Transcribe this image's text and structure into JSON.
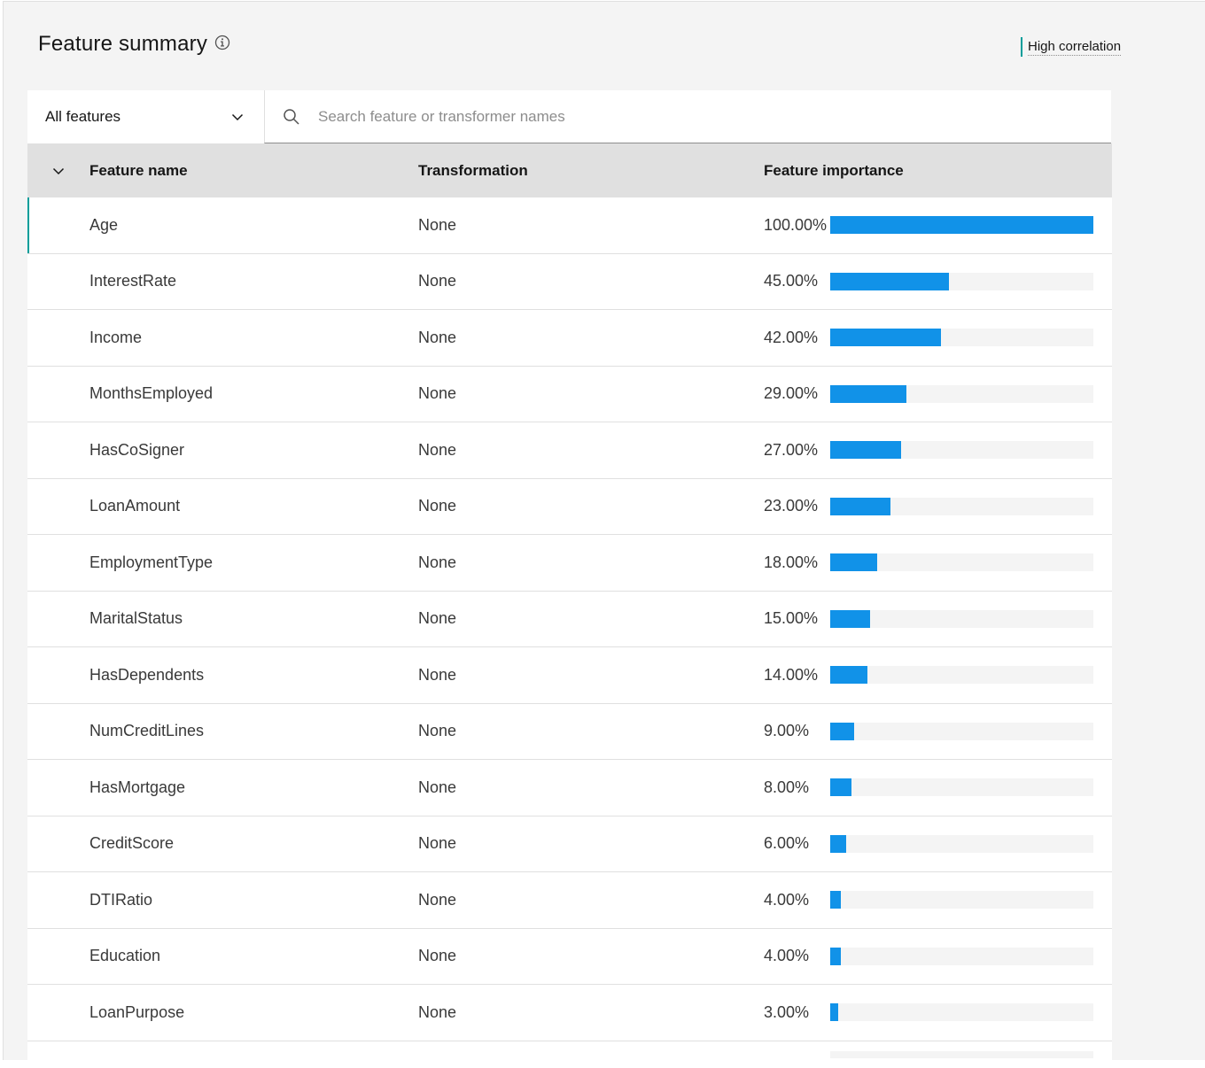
{
  "header": {
    "title": "Feature summary",
    "legend_label": "High correlation",
    "legend_color": "#009d9a"
  },
  "toolbar": {
    "filter_value": "All features",
    "search_placeholder": "Search feature or transformer names"
  },
  "table": {
    "columns": [
      "Feature name",
      "Transformation",
      "Feature importance"
    ],
    "bar_color": "#1192e8",
    "rows": [
      {
        "name": "Age",
        "transformation": "None",
        "importance": "100.00%",
        "value": 100
      },
      {
        "name": "InterestRate",
        "transformation": "None",
        "importance": "45.00%",
        "value": 45
      },
      {
        "name": "Income",
        "transformation": "None",
        "importance": "42.00%",
        "value": 42
      },
      {
        "name": "MonthsEmployed",
        "transformation": "None",
        "importance": "29.00%",
        "value": 29
      },
      {
        "name": "HasCoSigner",
        "transformation": "None",
        "importance": "27.00%",
        "value": 27
      },
      {
        "name": "LoanAmount",
        "transformation": "None",
        "importance": "23.00%",
        "value": 23
      },
      {
        "name": "EmploymentType",
        "transformation": "None",
        "importance": "18.00%",
        "value": 18
      },
      {
        "name": "MaritalStatus",
        "transformation": "None",
        "importance": "15.00%",
        "value": 15
      },
      {
        "name": "HasDependents",
        "transformation": "None",
        "importance": "14.00%",
        "value": 14
      },
      {
        "name": "NumCreditLines",
        "transformation": "None",
        "importance": "9.00%",
        "value": 9
      },
      {
        "name": "HasMortgage",
        "transformation": "None",
        "importance": "8.00%",
        "value": 8
      },
      {
        "name": "CreditScore",
        "transformation": "None",
        "importance": "6.00%",
        "value": 6
      },
      {
        "name": "DTIRatio",
        "transformation": "None",
        "importance": "4.00%",
        "value": 4
      },
      {
        "name": "Education",
        "transformation": "None",
        "importance": "4.00%",
        "value": 4
      },
      {
        "name": "LoanPurpose",
        "transformation": "None",
        "importance": "3.00%",
        "value": 3
      }
    ]
  }
}
